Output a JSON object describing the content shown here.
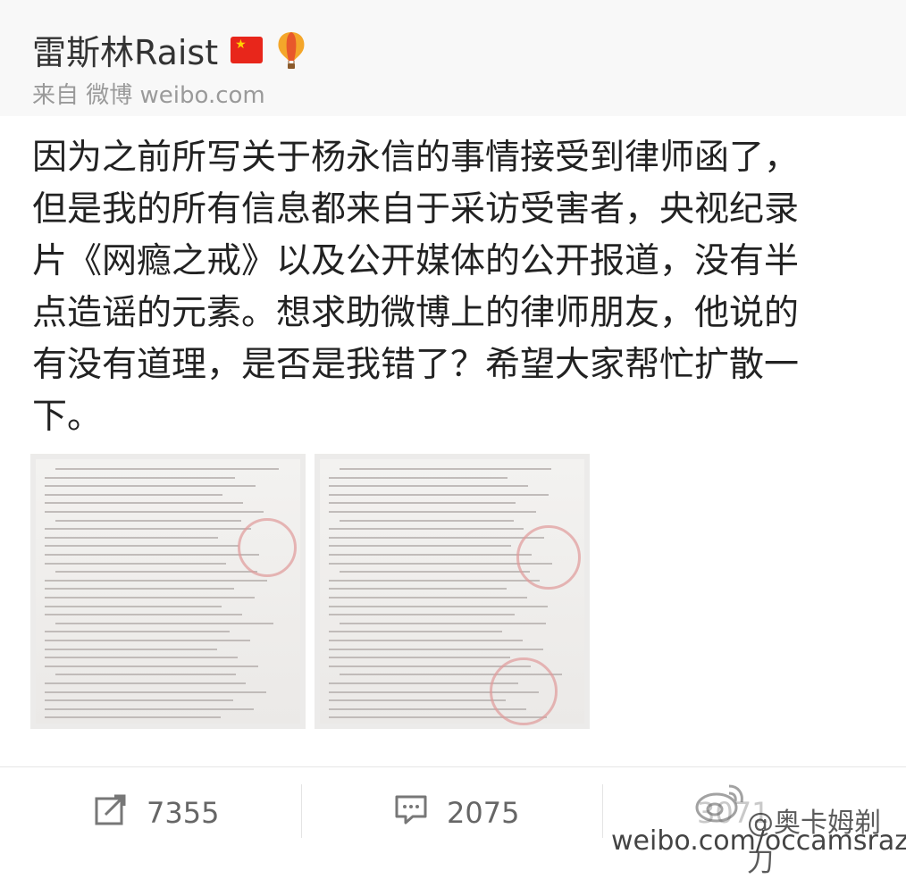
{
  "header": {
    "username": "雷斯林Raist",
    "source": "来自 微博 weibo.com",
    "badges": [
      "china-flag-icon",
      "hot-air-balloon-icon"
    ]
  },
  "post": {
    "text": "因为之前所写关于杨永信的事情接受到律师函了，\n但是我的所有信息都来自于采访受害者，央视纪录\n片《网瘾之戒》以及公开媒体的公开报道，没有半\n点造谣的元素。想求助微博上的律师朋友，他说的\n有没有道理，是否是我错了？希望大家帮忙扩散一\n下。"
  },
  "actions": {
    "repost_count": "7355",
    "comment_count": "2075",
    "like_count": "3071"
  },
  "watermark": {
    "handle": "@奥卡姆剃刀",
    "url": "weibo.com/occamsrazor"
  },
  "colors": {
    "header_bg": "#f8f8f8",
    "text": "#222222",
    "muted": "#9a9a9a",
    "flag_red": "#e8261b"
  }
}
